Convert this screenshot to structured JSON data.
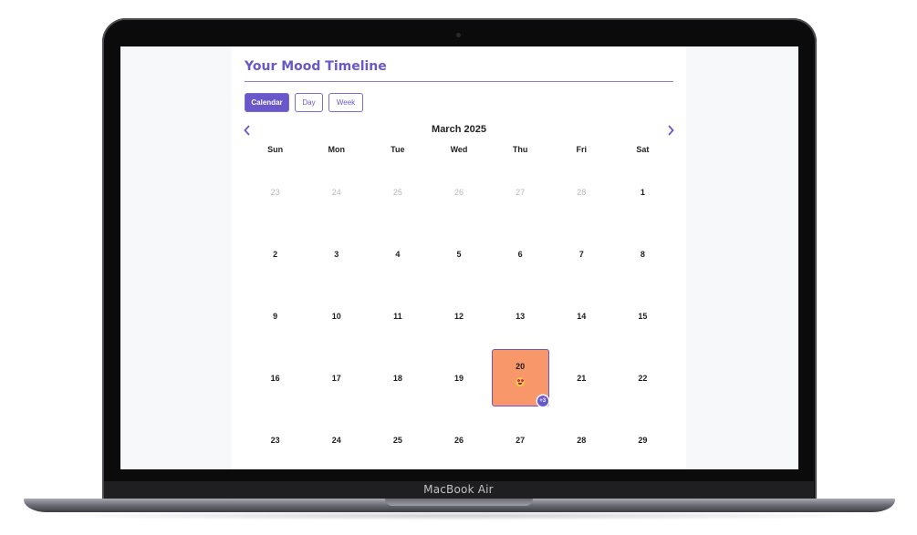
{
  "device": {
    "brand_label": "MacBook Air"
  },
  "app": {
    "title": "Your Mood Timeline",
    "accent_color": "#6a57c9",
    "tabs": [
      {
        "label": "Calendar",
        "active": true
      },
      {
        "label": "Day",
        "active": false
      },
      {
        "label": "Week",
        "active": false
      }
    ],
    "calendar": {
      "month_label": "March 2025",
      "prev_icon": "chevron-left-icon",
      "next_icon": "chevron-right-icon",
      "weekdays": [
        "Sun",
        "Mon",
        "Tue",
        "Wed",
        "Thu",
        "Fri",
        "Sat"
      ],
      "weeks": [
        [
          "23",
          "24",
          "25",
          "26",
          "27",
          "28",
          "1"
        ],
        [
          "2",
          "3",
          "4",
          "5",
          "6",
          "7",
          "8"
        ],
        [
          "9",
          "10",
          "11",
          "12",
          "13",
          "14",
          "15"
        ],
        [
          "16",
          "17",
          "18",
          "19",
          "20",
          "21",
          "22"
        ],
        [
          "23",
          "24",
          "25",
          "26",
          "27",
          "28",
          "29"
        ]
      ],
      "selected_day": {
        "day": "20",
        "mood_icon": "heart-eyes-emoji-icon",
        "badge": "+3",
        "color": "#f7976a"
      }
    }
  }
}
